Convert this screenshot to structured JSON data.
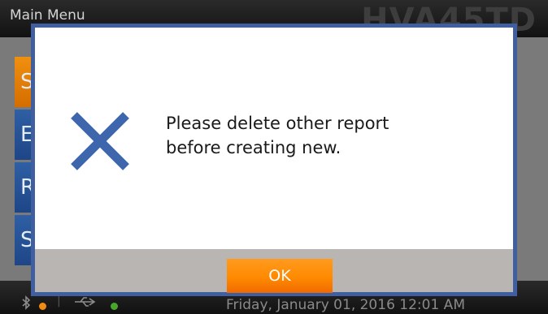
{
  "header": {
    "title": "Main Menu",
    "model": "HVA45TD"
  },
  "menu": {
    "items": [
      {
        "label": "S"
      },
      {
        "label": "E"
      },
      {
        "label": "R"
      },
      {
        "label": "S"
      }
    ]
  },
  "status": {
    "datetime": "Friday, January 01, 2016 12:01 AM",
    "bluetooth_icon": "bluetooth-icon",
    "usb_icon": "usb-icon",
    "colors": {
      "orange_dot": "#f08c10",
      "green_dot": "#47a72b"
    }
  },
  "dialog": {
    "icon": "error-x-icon",
    "message_line1": "Please delete other report",
    "message_line2": "before creating new.",
    "ok_label": "OK",
    "colors": {
      "border": "#3f5fa0",
      "x_icon": "#3e66ad",
      "button": "#ff8a00",
      "footer": "#b9b5b3"
    }
  }
}
